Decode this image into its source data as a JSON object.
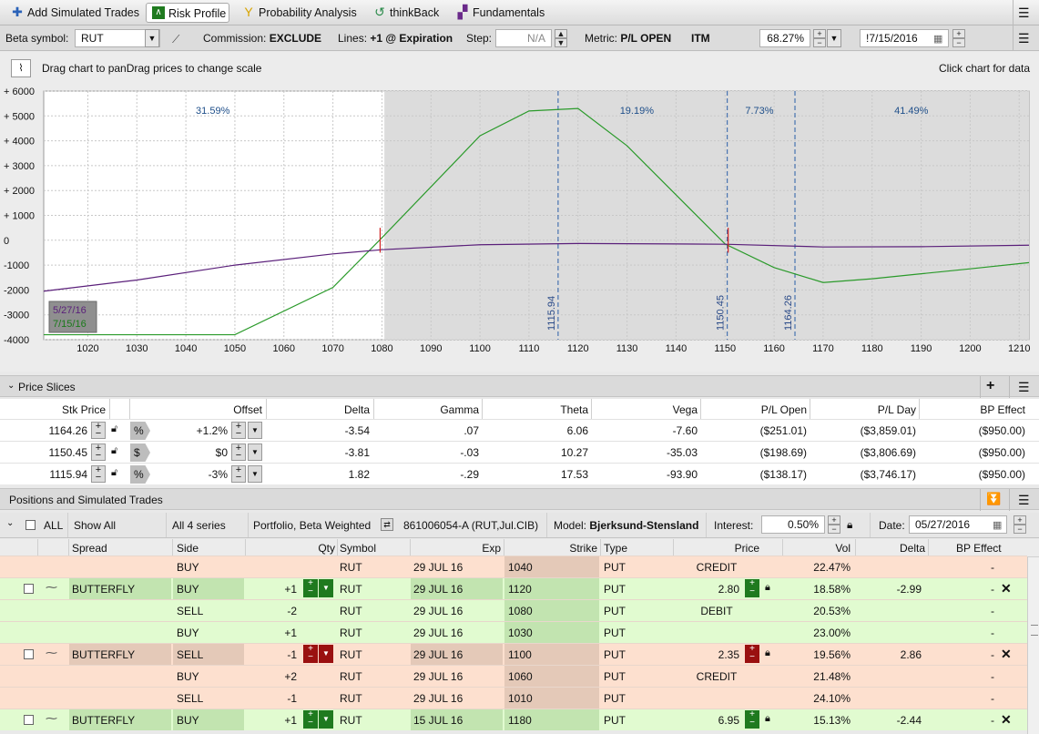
{
  "tabs": [
    {
      "label": "Add Simulated Trades",
      "icon": "plus-icon"
    },
    {
      "label": "Risk Profile",
      "icon": "risk-profile-icon"
    },
    {
      "label": "Probability Analysis",
      "icon": "probability-icon"
    },
    {
      "label": "thinkBack",
      "icon": "history-icon"
    },
    {
      "label": "Fundamentals",
      "icon": "fundamentals-icon"
    }
  ],
  "controls": {
    "beta_label": "Beta symbol:",
    "beta_value": "RUT",
    "commission_label": "Commission:",
    "commission_value": "EXCLUDE",
    "lines_label": "Lines:",
    "lines_value": "+1 @ Expiration",
    "step_label": "Step:",
    "step_value": "N/A",
    "metric_label": "Metric:",
    "metric_value": "P/L OPEN",
    "itm_label": "ITM",
    "volatility_value": "68.27%",
    "date_value": "!7/15/2016"
  },
  "hint": {
    "left": "Drag chart to panDrag prices to change scale",
    "right": "Click chart for data"
  },
  "chart_data": {
    "type": "line",
    "x_ticks": [
      1020,
      1030,
      1040,
      1050,
      1060,
      1070,
      1080,
      1090,
      1100,
      1110,
      1120,
      1130,
      1140,
      1150,
      1160,
      1170,
      1180,
      1190,
      1200,
      1210
    ],
    "y_ticks": [
      "+ 6000",
      "+ 5000",
      "+ 4000",
      "+ 3000",
      "+ 2000",
      "+ 1000",
      "0",
      "-1000",
      "-2000",
      "-3000",
      "-4000"
    ],
    "xlim": [
      1011,
      1212
    ],
    "ylim": [
      -4000,
      6000
    ],
    "series": [
      {
        "name": "7/15/16",
        "color": "#2a9a2a",
        "x": [
          1011,
          1050,
          1070,
          1080,
          1100,
          1110,
          1120,
          1130,
          1150,
          1160,
          1170,
          1180,
          1190,
          1200,
          1212
        ],
        "y": [
          -3800,
          -3800,
          -1900,
          100,
          4200,
          5200,
          5300,
          3800,
          -150,
          -1100,
          -1700,
          -1550,
          -1350,
          -1150,
          -900
        ]
      },
      {
        "name": "5/27/16",
        "color": "#5a1f7a",
        "x": [
          1011,
          1030,
          1050,
          1070,
          1080,
          1100,
          1120,
          1140,
          1150,
          1170,
          1190,
          1212
        ],
        "y": [
          -2050,
          -1600,
          -1000,
          -550,
          -380,
          -180,
          -130,
          -150,
          -160,
          -270,
          -260,
          -200
        ]
      }
    ],
    "probability_regions": [
      {
        "label": "31.59%",
        "x": 1045.5
      },
      {
        "label": "19.19%",
        "x": 1132
      },
      {
        "label": "7.73%",
        "x": 1157
      },
      {
        "label": "41.49%",
        "x": 1188
      }
    ],
    "price_lines": [
      {
        "label": "1115.94",
        "x": 1115.94
      },
      {
        "label": "1150.45",
        "x": 1150.45
      },
      {
        "label": "1164.26",
        "x": 1164.26
      }
    ],
    "shaded_from": 1080.5,
    "legend": [
      "5/27/16",
      "7/15/16"
    ],
    "grid": true
  },
  "price_slices": {
    "title": "Price Slices",
    "columns": [
      "Stk Price",
      "Offset",
      "Delta",
      "Gamma",
      "Theta",
      "Vega",
      "P/L Open",
      "P/L Day",
      "BP Effect"
    ],
    "rows": [
      {
        "stk": "1164.26",
        "mode": "%",
        "offset": "+1.2%",
        "delta": "-3.54",
        "gamma": ".07",
        "theta": "6.06",
        "vega": "-7.60",
        "plopen": "($251.01)",
        "plday": "($3,859.01)",
        "bp": "($950.00)"
      },
      {
        "stk": "1150.45",
        "mode": "$",
        "offset": "$0",
        "delta": "-3.81",
        "gamma": "-.03",
        "theta": "10.27",
        "vega": "-35.03",
        "plopen": "($198.69)",
        "plday": "($3,806.69)",
        "bp": "($950.00)"
      },
      {
        "stk": "1115.94",
        "mode": "%",
        "offset": "-3%",
        "delta": "1.82",
        "gamma": "-.29",
        "theta": "17.53",
        "vega": "-93.90",
        "plopen": "($138.17)",
        "plday": "($3,746.17)",
        "bp": "($950.00)"
      }
    ]
  },
  "positions": {
    "title": "Positions and Simulated Trades",
    "toolbar": {
      "all": "ALL",
      "show": "Show All",
      "series": "All 4 series",
      "portfolio": "Portfolio, Beta Weighted",
      "account": "861006054-A (RUT,Jul.CIB)",
      "model_label": "Model:",
      "model": "Bjerksund-Stensland",
      "interest_label": "Interest:",
      "interest": "0.50%",
      "date_label": "Date:",
      "date": "05/27/2016"
    },
    "columns": [
      "Spread",
      "Side",
      "Qty",
      "Symbol",
      "Exp",
      "Strike",
      "Type",
      "Price",
      "Vol",
      "Delta",
      "BP Effect"
    ],
    "rows": [
      {
        "color": "salmon",
        "spread": "",
        "side": "BUY",
        "qty": "",
        "sym": "RUT",
        "exp": "29 JUL 16",
        "strike": "1040",
        "type": "PUT",
        "price": "CREDIT",
        "vol": "22.47%",
        "delta": "",
        "bp": "-",
        "main": false
      },
      {
        "color": "green",
        "spread": "BUTTERFLY",
        "side": "BUY",
        "qty": "+1",
        "sym": "RUT",
        "exp": "29 JUL 16",
        "strike": "1120",
        "type": "PUT",
        "price": "2.80",
        "vol": "18.58%",
        "delta": "-2.99",
        "bp": "-",
        "main": true
      },
      {
        "color": "green",
        "spread": "",
        "side": "SELL",
        "qty": "-2",
        "sym": "RUT",
        "exp": "29 JUL 16",
        "strike": "1080",
        "type": "PUT",
        "price": "DEBIT",
        "vol": "20.53%",
        "delta": "",
        "bp": "-",
        "main": false
      },
      {
        "color": "green",
        "spread": "",
        "side": "BUY",
        "qty": "+1",
        "sym": "RUT",
        "exp": "29 JUL 16",
        "strike": "1030",
        "type": "PUT",
        "price": "",
        "vol": "23.00%",
        "delta": "",
        "bp": "-",
        "main": false
      },
      {
        "color": "salmon",
        "spread": "BUTTERFLY",
        "side": "SELL",
        "qty": "-1",
        "sym": "RUT",
        "exp": "29 JUL 16",
        "strike": "1100",
        "type": "PUT",
        "price": "2.35",
        "vol": "19.56%",
        "delta": "2.86",
        "bp": "-",
        "main": true
      },
      {
        "color": "salmon",
        "spread": "",
        "side": "BUY",
        "qty": "+2",
        "sym": "RUT",
        "exp": "29 JUL 16",
        "strike": "1060",
        "type": "PUT",
        "price": "CREDIT",
        "vol": "21.48%",
        "delta": "",
        "bp": "-",
        "main": false
      },
      {
        "color": "salmon",
        "spread": "",
        "side": "SELL",
        "qty": "-1",
        "sym": "RUT",
        "exp": "29 JUL 16",
        "strike": "1010",
        "type": "PUT",
        "price": "",
        "vol": "24.10%",
        "delta": "",
        "bp": "-",
        "main": false
      },
      {
        "color": "green",
        "spread": "BUTTERFLY",
        "side": "BUY",
        "qty": "+1",
        "sym": "RUT",
        "exp": "15 JUL 16",
        "strike": "1180",
        "type": "PUT",
        "price": "6.95",
        "vol": "15.13%",
        "delta": "-2.44",
        "bp": "-",
        "main": true
      }
    ]
  },
  "colors": {
    "green_row": "#e1fbd0",
    "salmon_row": "#fde0cf",
    "buy_btn": "#1f7a1f",
    "sell_btn": "#9a1010",
    "chart_green": "#2a9a2a",
    "chart_purple": "#5a1f7a",
    "price_line": "#2a5ea8"
  }
}
